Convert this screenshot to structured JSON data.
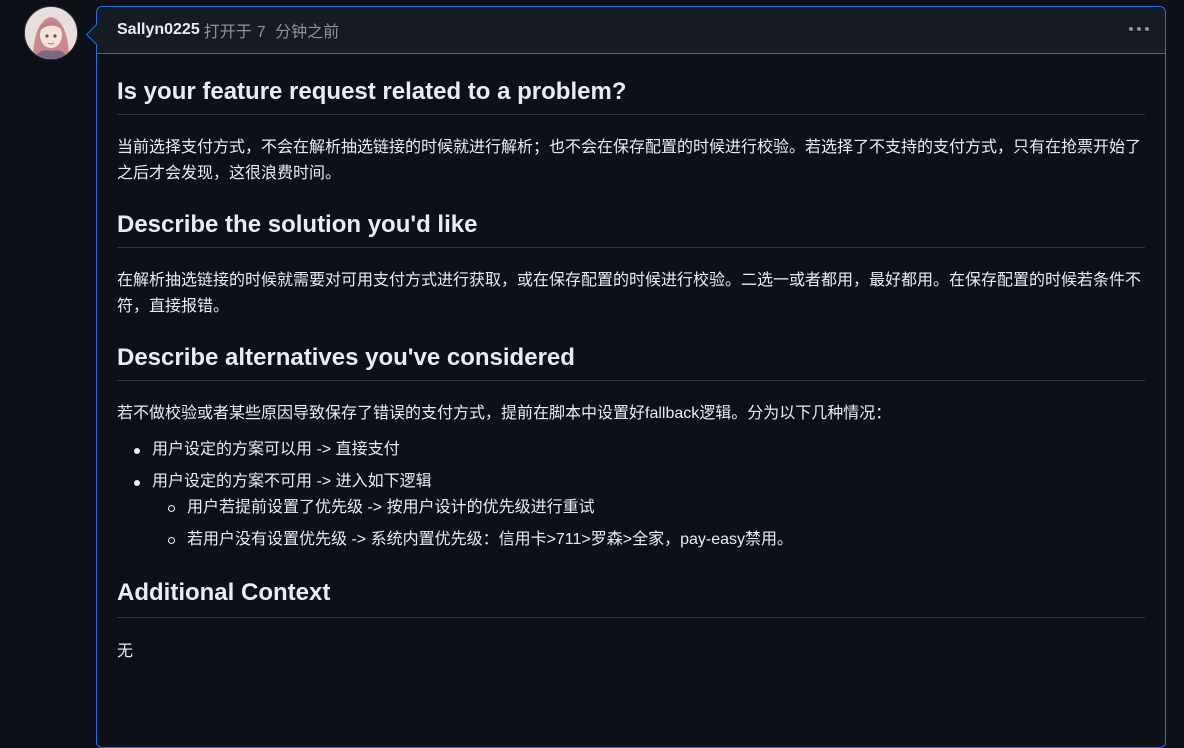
{
  "comment": {
    "author": "Sallyn0225",
    "action": "打开于",
    "time_number": "7",
    "time_unit": "分钟之前"
  },
  "sections": [
    {
      "heading": "Is your feature request related to a problem?",
      "paragraph": "当前选择支付方式，不会在解析抽选链接的时候就进行解析；也不会在保存配置的时候进行校验。若选择了不支持的支付方式，只有在抢票开始了之后才会发现，这很浪费时间。"
    },
    {
      "heading": "Describe the solution you'd like",
      "paragraph": "在解析抽选链接的时候就需要对可用支付方式进行获取，或在保存配置的时候进行校验。二选一或者都用，最好都用。在保存配置的时候若条件不符，直接报错。"
    },
    {
      "heading": "Describe alternatives you've considered",
      "paragraph": "若不做校验或者某些原因导致保存了错误的支付方式，提前在脚本中设置好fallback逻辑。分为以下几种情况：",
      "list": [
        {
          "text": "用户设定的方案可以用 -> 直接支付"
        },
        {
          "text": "用户设定的方案不可用 -> 进入如下逻辑",
          "sublist": [
            "用户若提前设置了优先级 -> 按用户设计的优先级进行重试",
            "若用户没有设置优先级 -> 系统内置优先级：信用卡>711>罗森>全家，pay-easy禁用。"
          ]
        }
      ]
    },
    {
      "heading": "Additional Context",
      "paragraph": "无"
    }
  ],
  "icons": {
    "more": "kebab-horizontal-icon",
    "avatar": "anime-avatar"
  },
  "colors": {
    "background": "#0d1117",
    "header_bg": "#161b22",
    "focus_border": "#1f6feb",
    "divider": "#30363d",
    "text": "#e6edf3",
    "muted": "#8b949e"
  }
}
